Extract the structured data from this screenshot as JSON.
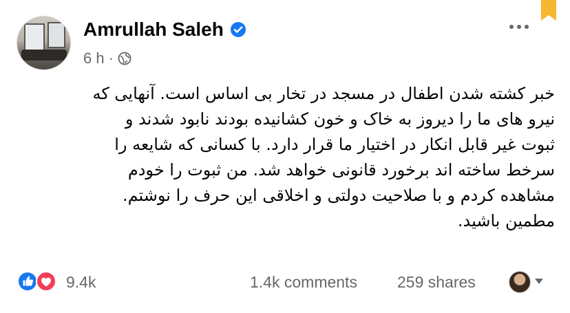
{
  "post": {
    "author": "Amrullah Saleh",
    "time": "6 h",
    "separator": "·",
    "text_lines": [
      "خبر کشته شدن اطفال در مسجد در تخار بی اساس است. آنهایی که",
      "نیرو های ما را دیروز به  خاک و خون کشانیده بودند نابود شدند و",
      "ثبوت غیر قابل انکار در اختیار ما قرار دارد. با کسانی که  شایعه را",
      "سرخط ساخته اند برخورد قانونی خواهد شد.  من ثبوت را خودم",
      "مشاهده کردم و با صلاحیت دولتی و اخلاقی این حرف را نوشتم.",
      "مطمین باشید."
    ],
    "reactions_count": "9.4k",
    "comments": "1.4k comments",
    "shares": "259 shares"
  },
  "icons": {
    "verified": "verified-badge-icon",
    "audience": "globe-icon",
    "like": "like-icon",
    "love": "love-icon",
    "more": "more-options-icon",
    "bookmark": "bookmark-icon",
    "caret": "chevron-down-icon"
  },
  "colors": {
    "facebook_blue": "#1877f2",
    "love_red": "#f33e58",
    "secondary_text": "#65676b",
    "bookmark_gold": "#f5b82e"
  }
}
